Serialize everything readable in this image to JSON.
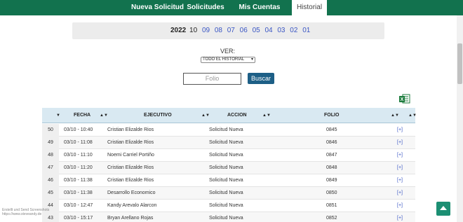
{
  "nav": {
    "items": [
      {
        "label": "Nueva Solicitud"
      },
      {
        "label": "Solicitudes"
      },
      {
        "label": "Mis Cuentas"
      },
      {
        "label": "Historial"
      }
    ]
  },
  "filters": {
    "year": "2022",
    "current_month": "10",
    "months": [
      "09",
      "08",
      "07",
      "06",
      "05",
      "04",
      "03",
      "02",
      "01"
    ],
    "ver_label": "VER:",
    "ver_selected": "TODO EL HISTORIAL",
    "folio_placeholder": "Folio",
    "search_label": "Buscar"
  },
  "table": {
    "headers": {
      "fecha": "FECHA",
      "ejecutivo": "EJECUTIVO",
      "accion": "ACCION",
      "folio": "FOLIO"
    },
    "rows": [
      {
        "num": "50",
        "fecha": "03/10 - 10:40",
        "ejecutivo": "Cristian Elizalde Rios",
        "accion": "Solicitud Nueva",
        "folio": "0845",
        "link": "[+]"
      },
      {
        "num": "49",
        "fecha": "03/10 - 11:08",
        "ejecutivo": "Cristian Elizalde Rios",
        "accion": "Solicitud Nueva",
        "folio": "0846",
        "link": "[+]"
      },
      {
        "num": "48",
        "fecha": "03/10 - 11:10",
        "ejecutivo": "Noemi Carriel Portiño",
        "accion": "Solicitud Nueva",
        "folio": "0847",
        "link": "[+]"
      },
      {
        "num": "47",
        "fecha": "03/10 - 11:20",
        "ejecutivo": "Cristian Elizalde Rios",
        "accion": "Solicitud Nueva",
        "folio": "0848",
        "link": "[+]"
      },
      {
        "num": "46",
        "fecha": "03/10 - 11:38",
        "ejecutivo": "Cristian Elizalde Rios",
        "accion": "Solicitud Nueva",
        "folio": "0849",
        "link": "[+]"
      },
      {
        "num": "45",
        "fecha": "03/10 - 11:38",
        "ejecutivo": "Desarrollo Economico",
        "accion": "Solicitud Nueva",
        "folio": "0850",
        "link": "[+]"
      },
      {
        "num": "44",
        "fecha": "03/10 - 12:47",
        "ejecutivo": "Kandy Arevalo Alarcon",
        "accion": "Solicitud Nueva",
        "folio": "0851",
        "link": "[+]"
      },
      {
        "num": "43",
        "fecha": "03/10 - 15:17",
        "ejecutivo": "Bryan Arellano Rojas",
        "accion": "Solicitud Nueva",
        "folio": "0852",
        "link": "[+]"
      }
    ]
  },
  "watermark": {
    "line1": "Erstellt und Send Screenshots",
    "line2": "https://www.steveandy.de"
  },
  "colors": {
    "nav_bg": "#12724e",
    "header_bg": "#d9e9f2",
    "button_bg": "#1d5f86",
    "link": "#3a56c4",
    "totop_bg": "#1c8f73"
  }
}
